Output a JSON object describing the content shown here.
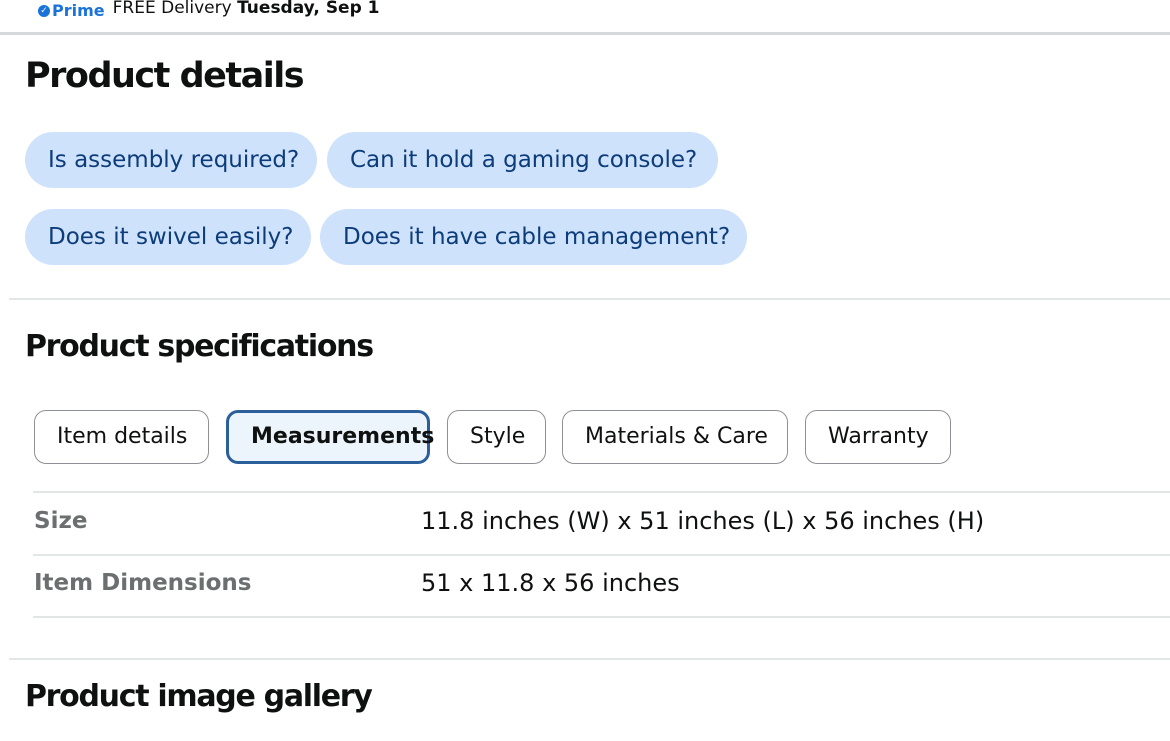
{
  "delivery": {
    "prime_label": "Prime",
    "text": "FREE Delivery",
    "date": "Tuesday, Sep 1"
  },
  "product_details": {
    "title": "Product details",
    "questions": [
      "Is assembly required?",
      "Can it hold a gaming console?",
      "Does it swivel easily?",
      "Does it have cable management?"
    ]
  },
  "product_specifications": {
    "title": "Product specifications",
    "tabs": [
      {
        "label": "Item details",
        "active": false
      },
      {
        "label": "Measurements",
        "active": true
      },
      {
        "label": "Style",
        "active": false
      },
      {
        "label": "Materials & Care",
        "active": false
      },
      {
        "label": "Warranty",
        "active": false
      }
    ],
    "rows": [
      {
        "label": "Size",
        "value": "11.8 inches (W) x 51 inches (L) x 56 inches (H)"
      },
      {
        "label": "Item Dimensions",
        "value": "51 x 11.8 x 56 inches"
      }
    ]
  },
  "product_image_gallery": {
    "title": "Product image gallery"
  },
  "colors": {
    "chip_bg": "#cfe2fb",
    "chip_text": "#0c3c7a",
    "prime_blue": "#1a73d9",
    "active_tab_border": "#2a5f9a"
  }
}
